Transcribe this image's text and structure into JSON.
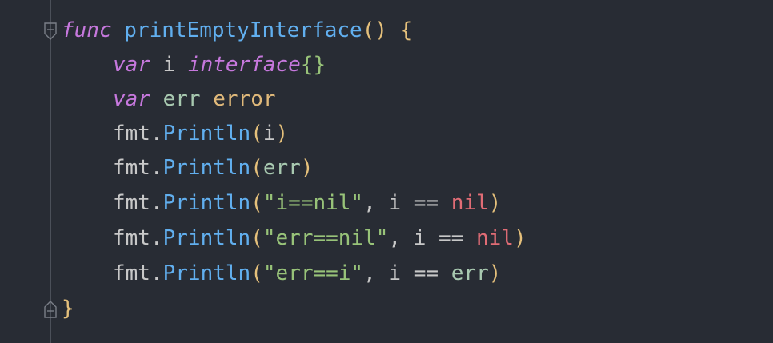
{
  "editor": {
    "lines": [
      {
        "tokens": {
          "kw": "func",
          "sp": " ",
          "name": "printEmptyInterface",
          "parens": "()",
          "brace": "{"
        }
      },
      {
        "tokens": {
          "kw": "var",
          "name": "i",
          "type": "interface",
          "braces": "{}"
        }
      },
      {
        "tokens": {
          "kw": "var",
          "name": "err",
          "type": "error"
        }
      },
      {
        "tokens": {
          "pkg": "fmt",
          "dot": ".",
          "fn": "Println",
          "open": "(",
          "arg": "i",
          "close": ")"
        }
      },
      {
        "tokens": {
          "pkg": "fmt",
          "dot": ".",
          "fn": "Println",
          "open": "(",
          "arg": "err",
          "close": ")"
        }
      },
      {
        "tokens": {
          "pkg": "fmt",
          "dot": ".",
          "fn": "Println",
          "open": "(",
          "str": "\"i==nil\"",
          "comma": ",",
          "lhs": "i",
          "op": "==",
          "rhs": "nil",
          "close": ")"
        }
      },
      {
        "tokens": {
          "pkg": "fmt",
          "dot": ".",
          "fn": "Println",
          "open": "(",
          "str": "\"err==nil\"",
          "comma": ",",
          "lhs": "i",
          "op": "==",
          "rhs": "nil",
          "close": ")"
        }
      },
      {
        "tokens": {
          "pkg": "fmt",
          "dot": ".",
          "fn": "Println",
          "open": "(",
          "str": "\"err==i\"",
          "comma": ",",
          "lhs": "i",
          "op": "==",
          "rhs": "err",
          "close": ")"
        }
      },
      {
        "tokens": {
          "brace": "}"
        }
      }
    ]
  },
  "colors": {
    "background": "#282c34",
    "keyword": "#c678dd",
    "function": "#61afef",
    "string": "#98c379",
    "nil": "#e06c75",
    "paren": "#e5c07b"
  }
}
